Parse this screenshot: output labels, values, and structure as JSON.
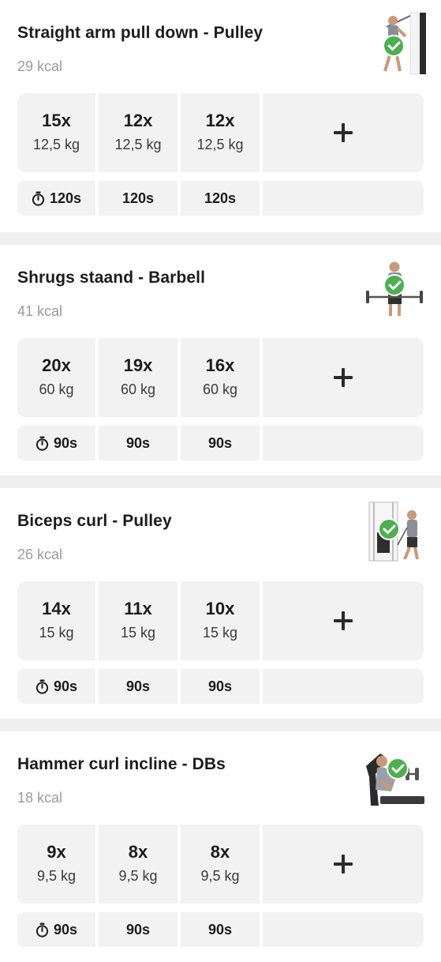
{
  "exercises": [
    {
      "title": "Straight arm pull down - Pulley",
      "kcal": "29 kcal",
      "sets": [
        {
          "reps": "15x",
          "weight": "12,5 kg",
          "rest": "120s"
        },
        {
          "reps": "12x",
          "weight": "12,5 kg",
          "rest": "120s"
        },
        {
          "reps": "12x",
          "weight": "12,5 kg",
          "rest": "120s"
        }
      ],
      "thumbnail_icon": "pulldown-figure-icon",
      "completed": true
    },
    {
      "title": "Shrugs staand - Barbell",
      "kcal": "41 kcal",
      "sets": [
        {
          "reps": "20x",
          "weight": "60 kg",
          "rest": "90s"
        },
        {
          "reps": "19x",
          "weight": "60 kg",
          "rest": "90s"
        },
        {
          "reps": "16x",
          "weight": "60 kg",
          "rest": "90s"
        }
      ],
      "thumbnail_icon": "barbell-shrug-figure-icon",
      "completed": true
    },
    {
      "title": "Biceps curl - Pulley",
      "kcal": "26 kcal",
      "sets": [
        {
          "reps": "14x",
          "weight": "15 kg",
          "rest": "90s"
        },
        {
          "reps": "11x",
          "weight": "15 kg",
          "rest": "90s"
        },
        {
          "reps": "10x",
          "weight": "15 kg",
          "rest": "90s"
        }
      ],
      "thumbnail_icon": "cable-curl-figure-icon",
      "completed": true
    },
    {
      "title": "Hammer curl incline - DBs",
      "kcal": "18 kcal",
      "sets": [
        {
          "reps": "9x",
          "weight": "9,5 kg",
          "rest": "90s"
        },
        {
          "reps": "8x",
          "weight": "9,5 kg",
          "rest": "90s"
        },
        {
          "reps": "8x",
          "weight": "9,5 kg",
          "rest": "90s"
        }
      ],
      "thumbnail_icon": "incline-dumbbell-curl-figure-icon",
      "completed": true
    }
  ],
  "add_set_icon": "plus-icon",
  "rest_icon": "stopwatch-icon",
  "colors": {
    "background": "#ffffff",
    "divider": "#efefef",
    "cell": "#f2f2f2",
    "text": "#1c1c1c",
    "muted": "#9a9a9a",
    "check": "#4caf50"
  }
}
